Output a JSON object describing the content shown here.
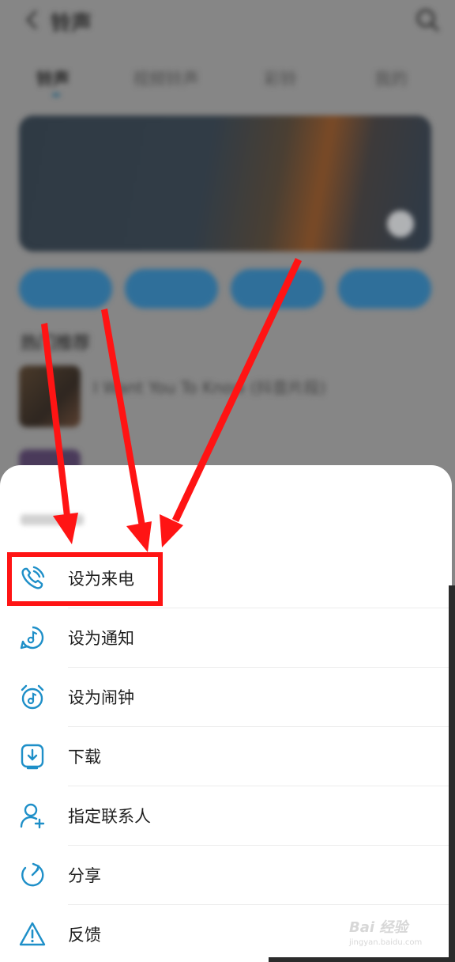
{
  "background": {
    "title": "铃声",
    "tabs": [
      "铃声",
      "视频铃声",
      "彩铃",
      "我的"
    ],
    "banner_tag": "",
    "banner_text": "",
    "chips": [
      "",
      "",
      "",
      ""
    ],
    "section_title": "热门推荐",
    "song_title": "I Want You To Know (抖音片段)",
    "song_meta": ""
  },
  "sheet": {
    "song_name": "",
    "items": [
      {
        "label": "设为来电",
        "icon": "incoming-call-icon"
      },
      {
        "label": "设为通知",
        "icon": "notification-icon"
      },
      {
        "label": "设为闹钟",
        "icon": "alarm-clock-icon"
      },
      {
        "label": "下载",
        "icon": "download-icon"
      },
      {
        "label": "指定联系人",
        "icon": "add-contact-icon"
      },
      {
        "label": "分享",
        "icon": "share-icon"
      },
      {
        "label": "反馈",
        "icon": "feedback-warning-icon"
      }
    ]
  },
  "colors": {
    "accent": "#1e8fc8",
    "annotation": "#ff1414"
  },
  "watermark": {
    "brand": "Bai 经验",
    "url": "jingyan.baidu.com"
  }
}
